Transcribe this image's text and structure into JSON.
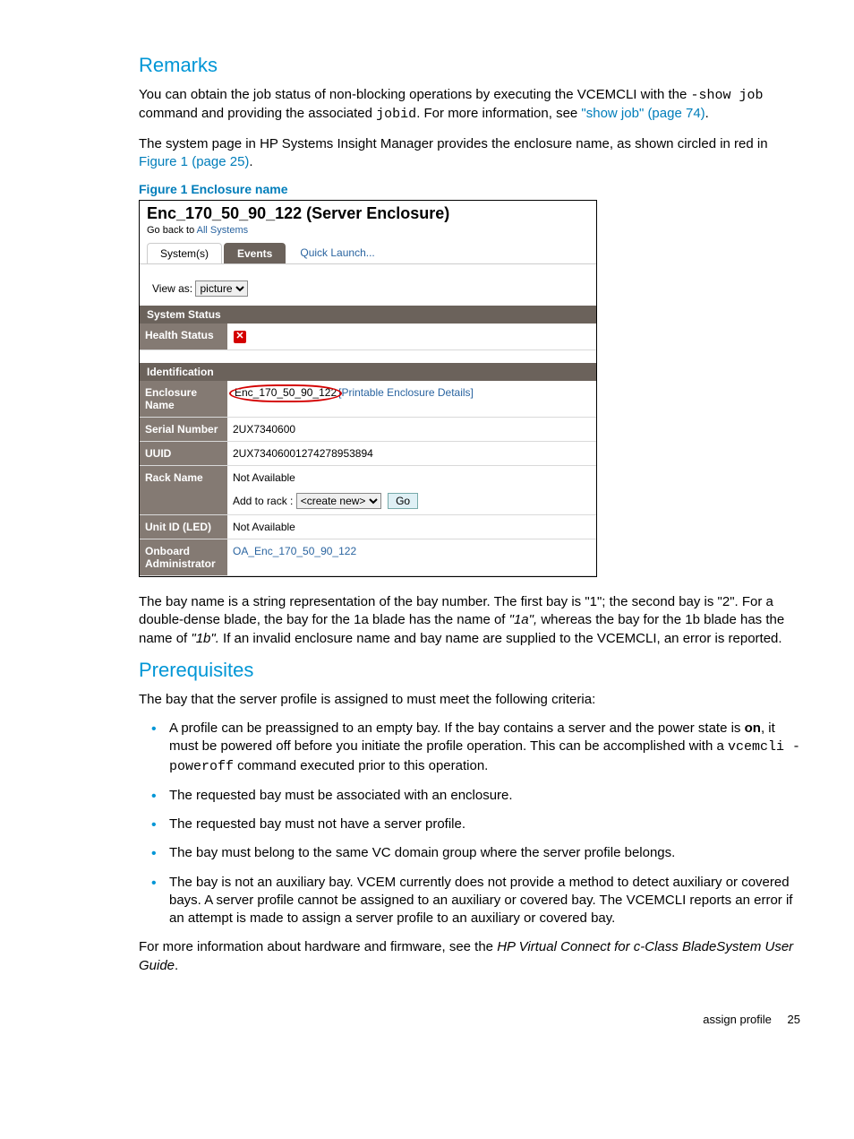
{
  "remarks_heading": "Remarks",
  "remarks_p1_a": "You can obtain the job status of non-blocking operations by executing the VCEMCLI with the ",
  "remarks_p1_cmd": "-show job",
  "remarks_p1_b": " command and providing the associated ",
  "remarks_p1_jobid": "jobid",
  "remarks_p1_c": ". For more information, see ",
  "remarks_p1_link": "\"show job\" (page 74)",
  "remarks_p1_d": ".",
  "remarks_p2_a": "The system page in HP Systems Insight Manager provides the enclosure name, as shown circled in red in ",
  "remarks_p2_link": "Figure 1 (page 25)",
  "remarks_p2_b": ".",
  "figcap": "Figure 1 Enclosure name",
  "sshot": {
    "title": "Enc_170_50_90_122 (Server Enclosure)",
    "goback_a": "Go back to ",
    "goback_link": "All Systems",
    "tab_systems": "System(s)",
    "tab_events": "Events",
    "quick_launch": "Quick Launch...",
    "viewas_label": "View as:",
    "viewas_option": "picture",
    "hdr_system_status": "System Status",
    "row_health_label": "Health Status",
    "hdr_identification": "Identification",
    "row_enc_label": "Enclosure Name",
    "row_enc_val": "Enc_170_50_90_122",
    "row_enc_details": "[Printable Enclosure Details]",
    "row_serial_label": "Serial Number",
    "row_serial_val": "2UX7340600",
    "row_uuid_label": "UUID",
    "row_uuid_val": "2UX73406001274278953894",
    "row_rack_label": "Rack Name",
    "row_rack_val": "Not Available",
    "row_rack_add_label": "Add to rack :",
    "row_rack_add_option": "<create new>",
    "row_rack_go": "Go",
    "row_unitid_label": "Unit ID (LED)",
    "row_unitid_val": "Not Available",
    "row_oa_label": "Onboard Administrator",
    "row_oa_val": "OA_Enc_170_50_90_122"
  },
  "bay_p_a": "The bay name is a string representation of the bay number. The first bay is \"1\"; the second bay is \"2\". For a double-dense blade, the bay for the 1a blade has the name of ",
  "bay_p_i1": "\"1a\",",
  "bay_p_b": " whereas the bay for the 1b blade has the name of ",
  "bay_p_i2": "\"1b\".",
  "bay_p_c": " If an invalid enclosure name and bay name are supplied to the VCEMCLI, an error is reported.",
  "prereq_heading": "Prerequisites",
  "prereq_intro": "The bay that the server profile is assigned to must meet the following criteria:",
  "bullets": {
    "b1a": "A profile can be preassigned to an empty bay. If the bay contains a server and the power state is ",
    "b1on": "on",
    "b1b": ", it must be powered off before you initiate the profile operation. This can be accomplished with a ",
    "b1cmd": "vcemcli -poweroff",
    "b1c": " command executed prior to this operation.",
    "b2": "The requested bay must be associated with an enclosure.",
    "b3": "The requested bay must not have a server profile.",
    "b4": "The bay must belong to the same VC domain group where the server profile belongs.",
    "b5": "The bay is not an auxiliary bay. VCEM currently does not provide a method to detect auxiliary or covered bays. A server profile cannot be assigned to an auxiliary or covered bay. The VCEMCLI reports an error if an attempt is made to assign a server profile to an auxiliary or covered bay."
  },
  "moreinfo_a": "For more information about hardware and firmware, see the ",
  "moreinfo_i": "HP Virtual Connect for c-Class BladeSystem User Guide",
  "moreinfo_b": ".",
  "footer_label": "assign profile",
  "footer_page": "25"
}
